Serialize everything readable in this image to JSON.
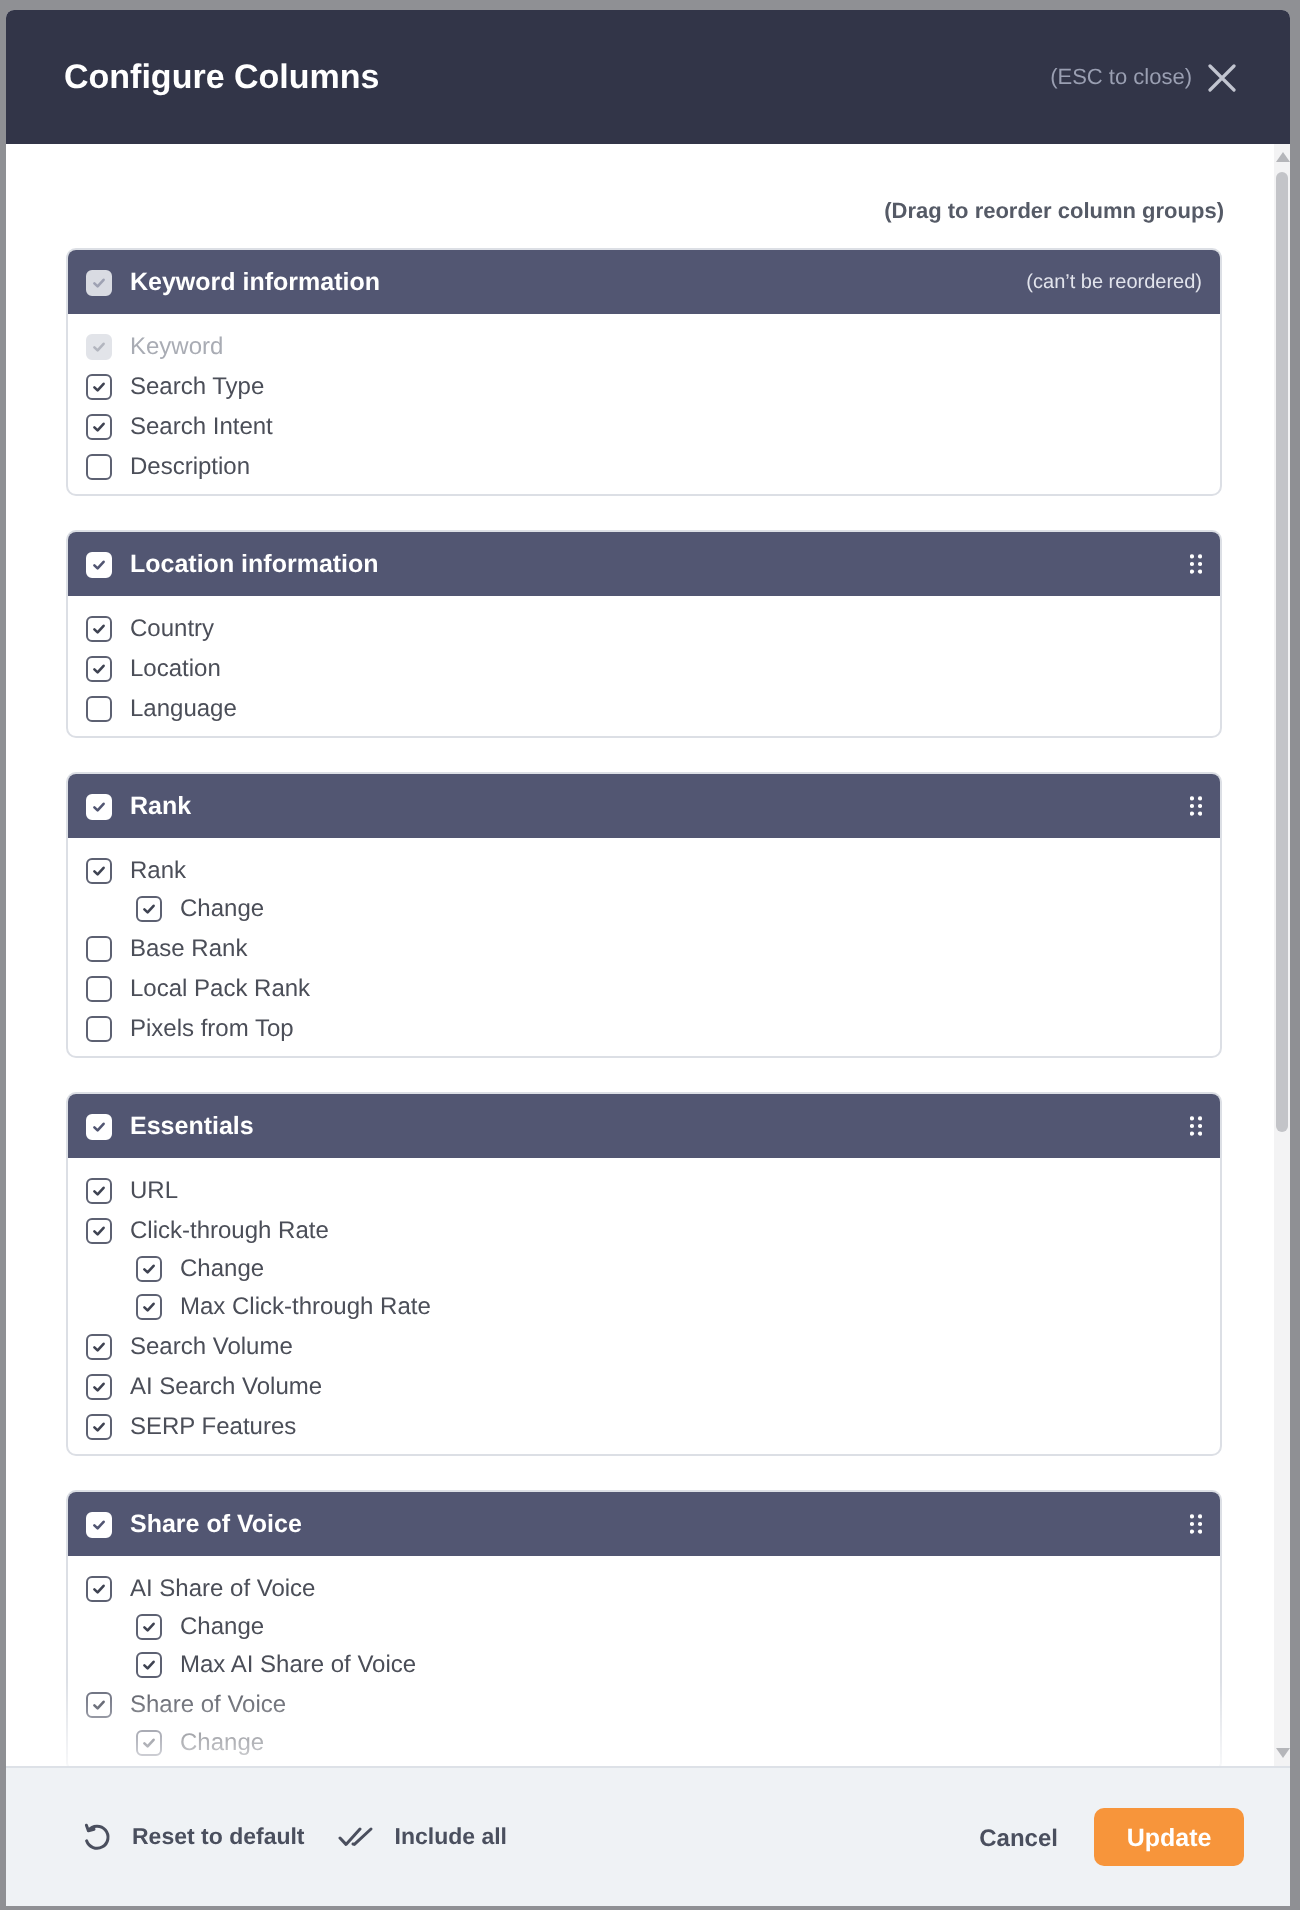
{
  "dialog": {
    "title": "Configure Columns",
    "close_hint": "(ESC to close)"
  },
  "reorder_hint": "(Drag to reorder column groups)",
  "groups": [
    {
      "title": "Keyword information",
      "checked": true,
      "disabled": true,
      "note": "(can’t be reordered)",
      "draggable": false,
      "columns": [
        {
          "label": "Keyword",
          "checked": true,
          "disabled": true
        },
        {
          "label": "Search Type",
          "checked": true,
          "disabled": false
        },
        {
          "label": "Search Intent",
          "checked": true,
          "disabled": false
        },
        {
          "label": "Description",
          "checked": false,
          "disabled": false
        }
      ]
    },
    {
      "title": "Location information",
      "checked": true,
      "disabled": false,
      "draggable": true,
      "columns": [
        {
          "label": "Country",
          "checked": true,
          "disabled": false
        },
        {
          "label": "Location",
          "checked": true,
          "disabled": false
        },
        {
          "label": "Language",
          "checked": false,
          "disabled": false
        }
      ]
    },
    {
      "title": "Rank",
      "checked": true,
      "disabled": false,
      "draggable": true,
      "columns": [
        {
          "label": "Rank",
          "checked": true,
          "disabled": false,
          "children": [
            {
              "label": "Change",
              "checked": true,
              "disabled": false
            }
          ]
        },
        {
          "label": "Base Rank",
          "checked": false,
          "disabled": false
        },
        {
          "label": "Local Pack Rank",
          "checked": false,
          "disabled": false
        },
        {
          "label": "Pixels from Top",
          "checked": false,
          "disabled": false
        }
      ]
    },
    {
      "title": "Essentials",
      "checked": true,
      "disabled": false,
      "draggable": true,
      "columns": [
        {
          "label": "URL",
          "checked": true,
          "disabled": false
        },
        {
          "label": "Click-through Rate",
          "checked": true,
          "disabled": false,
          "children": [
            {
              "label": "Change",
              "checked": true,
              "disabled": false
            },
            {
              "label": "Max Click-through Rate",
              "checked": true,
              "disabled": false
            }
          ]
        },
        {
          "label": "Search Volume",
          "checked": true,
          "disabled": false
        },
        {
          "label": "AI Search Volume",
          "checked": true,
          "disabled": false
        },
        {
          "label": "SERP Features",
          "checked": true,
          "disabled": false
        }
      ]
    },
    {
      "title": "Share of Voice",
      "checked": true,
      "disabled": false,
      "draggable": true,
      "columns": [
        {
          "label": "AI Share of Voice",
          "checked": true,
          "disabled": false,
          "children": [
            {
              "label": "Change",
              "checked": true,
              "disabled": false
            },
            {
              "label": "Max AI Share of Voice",
              "checked": true,
              "disabled": false
            }
          ]
        },
        {
          "label": "Share of Voice",
          "checked": true,
          "disabled": false,
          "children": [
            {
              "label": "Change",
              "checked": true,
              "disabled": false
            }
          ]
        }
      ]
    }
  ],
  "footer": {
    "actions": [
      {
        "kind": "reset",
        "label": "Reset to default"
      },
      {
        "kind": "include_all",
        "label": "Include all"
      }
    ],
    "cancel": "Cancel",
    "submit": "Update"
  }
}
